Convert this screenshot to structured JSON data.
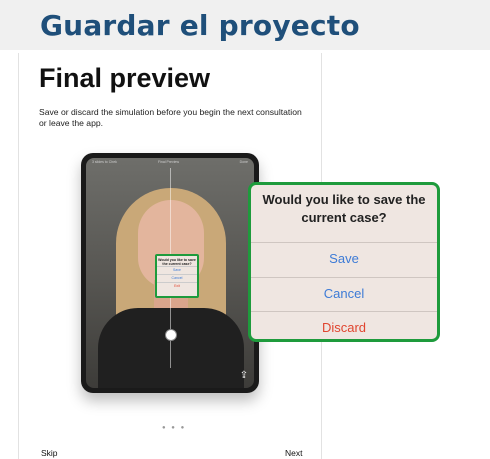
{
  "header": {
    "title": "Guardar el proyecto"
  },
  "screen": {
    "title": "Final preview",
    "description": "Save or discard the simulation before you begin the next consultation or leave the app.",
    "tablet_top": {
      "left": "3 slides to Chek",
      "center": "Final Preview",
      "right": "Done"
    },
    "mini_dialog": {
      "question": "Would you like to save the current case?",
      "save": "Save",
      "cancel": "Cancel",
      "discard": "Exit"
    },
    "page_dots": "● ● ●",
    "skip_label": "Skip",
    "next_label": "Next"
  },
  "dialog": {
    "question": "Would you like to save the current case?",
    "save_label": "Save",
    "cancel_label": "Cancel",
    "discard_label": "Discard"
  },
  "colors": {
    "title": "#1f4f7a",
    "highlight_border": "#1e9b3c",
    "action_blue": "#3d7bd6",
    "action_red": "#e0452f"
  },
  "icons": {
    "share": "share-icon",
    "handle": "drag-handle-icon"
  }
}
